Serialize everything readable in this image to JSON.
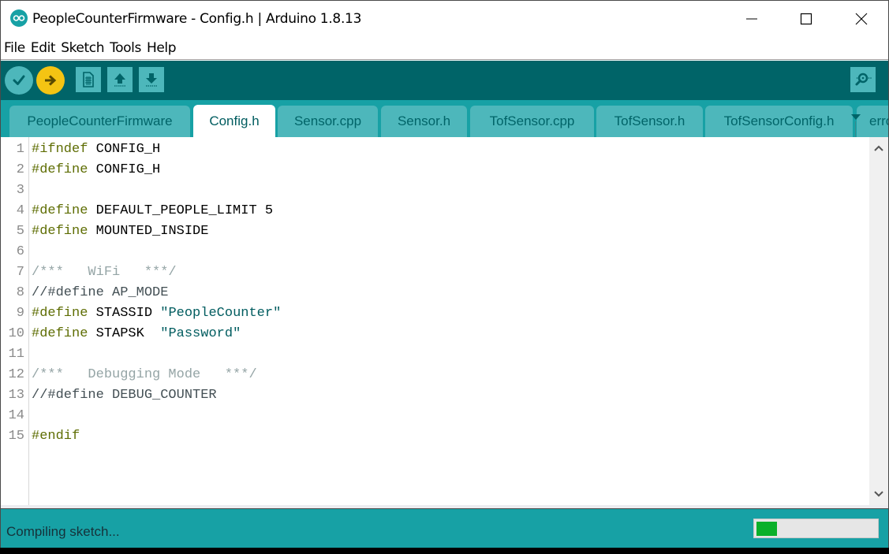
{
  "window": {
    "title": "PeopleCounterFirmware - Config.h | Arduino 1.8.13",
    "controls": {
      "minimize": "minimize",
      "maximize": "maximize",
      "close": "close"
    }
  },
  "menu": {
    "items": [
      "File",
      "Edit",
      "Sketch",
      "Tools",
      "Help"
    ]
  },
  "toolbar": {
    "buttons": [
      {
        "name": "verify",
        "icon": "checkmark-icon",
        "tooltip": "Verify"
      },
      {
        "name": "upload",
        "icon": "arrow-right-icon",
        "tooltip": "Upload"
      },
      {
        "name": "new",
        "icon": "new-file-icon",
        "tooltip": "New"
      },
      {
        "name": "open",
        "icon": "arrow-up-icon",
        "tooltip": "Open"
      },
      {
        "name": "save",
        "icon": "arrow-down-icon",
        "tooltip": "Save"
      },
      {
        "name": "serial-monitor",
        "icon": "magnifier-icon",
        "tooltip": "Serial Monitor"
      }
    ],
    "colors": {
      "bar": "#006468",
      "button": "#4db7bb",
      "upload_active": "#f4c413"
    }
  },
  "tabs": {
    "items": [
      {
        "label": "PeopleCounterFirmware",
        "active": false
      },
      {
        "label": "Config.h",
        "active": true
      },
      {
        "label": "Sensor.cpp",
        "active": false
      },
      {
        "label": "Sensor.h",
        "active": false
      },
      {
        "label": "TofSensor.cpp",
        "active": false
      },
      {
        "label": "TofSensor.h",
        "active": false
      },
      {
        "label": "TofSensorConfig.h",
        "active": false
      },
      {
        "label": "erro",
        "active": false
      }
    ]
  },
  "editor": {
    "lines": [
      {
        "n": "1",
        "tokens": [
          {
            "t": "#ifndef",
            "c": "pp"
          },
          {
            "t": " CONFIG_H",
            "c": "plain"
          }
        ]
      },
      {
        "n": "2",
        "tokens": [
          {
            "t": "#define",
            "c": "pp"
          },
          {
            "t": " CONFIG_H",
            "c": "plain"
          }
        ]
      },
      {
        "n": "3",
        "tokens": []
      },
      {
        "n": "4",
        "tokens": [
          {
            "t": "#define",
            "c": "pp"
          },
          {
            "t": " DEFAULT_PEOPLE_LIMIT 5",
            "c": "plain"
          }
        ]
      },
      {
        "n": "5",
        "tokens": [
          {
            "t": "#define",
            "c": "pp"
          },
          {
            "t": " MOUNTED_INSIDE",
            "c": "plain"
          }
        ]
      },
      {
        "n": "6",
        "tokens": []
      },
      {
        "n": "7",
        "tokens": [
          {
            "t": "/***   WiFi   ***/",
            "c": "cmt"
          }
        ]
      },
      {
        "n": "8",
        "tokens": [
          {
            "t": "//#define AP_MODE",
            "c": "cmtline"
          }
        ]
      },
      {
        "n": "9",
        "tokens": [
          {
            "t": "#define",
            "c": "pp"
          },
          {
            "t": " STASSID ",
            "c": "plain"
          },
          {
            "t": "\"PeopleCounter\"",
            "c": "str"
          }
        ]
      },
      {
        "n": "10",
        "tokens": [
          {
            "t": "#define",
            "c": "pp"
          },
          {
            "t": " STAPSK  ",
            "c": "plain"
          },
          {
            "t": "\"Password\"",
            "c": "str"
          }
        ]
      },
      {
        "n": "11",
        "tokens": []
      },
      {
        "n": "12",
        "tokens": [
          {
            "t": "/***   Debugging Mode   ***/",
            "c": "cmt"
          }
        ]
      },
      {
        "n": "13",
        "tokens": [
          {
            "t": "//#define DEBUG_COUNTER",
            "c": "cmtline"
          }
        ]
      },
      {
        "n": "14",
        "tokens": []
      },
      {
        "n": "15",
        "tokens": [
          {
            "t": "#endif",
            "c": "pp"
          }
        ]
      }
    ]
  },
  "status": {
    "message": "Compiling sketch...",
    "progress_percent": 17,
    "progress_color": "#0ab02a"
  }
}
